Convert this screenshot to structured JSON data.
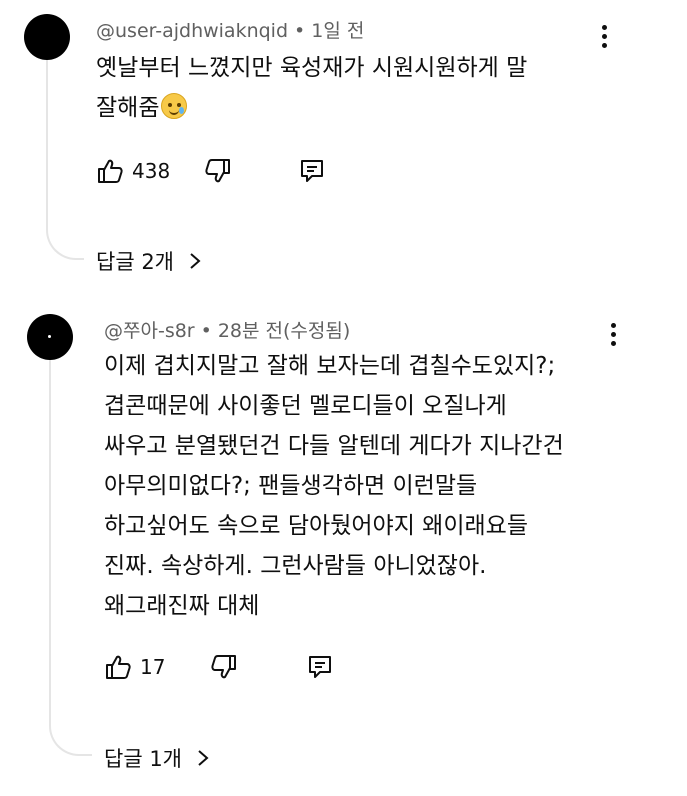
{
  "comments": [
    {
      "author": "@user-ajdhwiaknqid",
      "separator": "•",
      "time": "1일 전",
      "lines": [
        "옛날부터 느꼈지만 육성재가 시원시원하게 말",
        "잘해줌"
      ],
      "emoji": "smiling-face-with-tear",
      "likes": "438",
      "replies_label": "답글 2개"
    },
    {
      "author": "@쭈아-s8r",
      "separator": "•",
      "time": "28분 전(수정됨)",
      "lines": [
        "이제 겹치지말고 잘해 보자는데 겹칠수도있지?;",
        "겹콘때문에 사이좋던 멜로디들이 오질나게",
        "싸우고 분열됐던건 다들 알텐데 게다가 지나간건",
        "아무의미없다?; 팬들생각하면 이런말들",
        "하고싶어도 속으로 담아뒀어야지 왜이래요들",
        "진짜. 속상하게. 그런사람들 아니었잖아.",
        "왜그래진짜 대체"
      ],
      "likes": "17",
      "replies_label": "답글 1개"
    }
  ],
  "icons": {
    "like": "thumbs-up-icon",
    "dislike": "thumbs-down-icon",
    "reply": "reply-comment-icon",
    "more": "more-vertical-icon",
    "chevron": "chevron-right-icon"
  }
}
